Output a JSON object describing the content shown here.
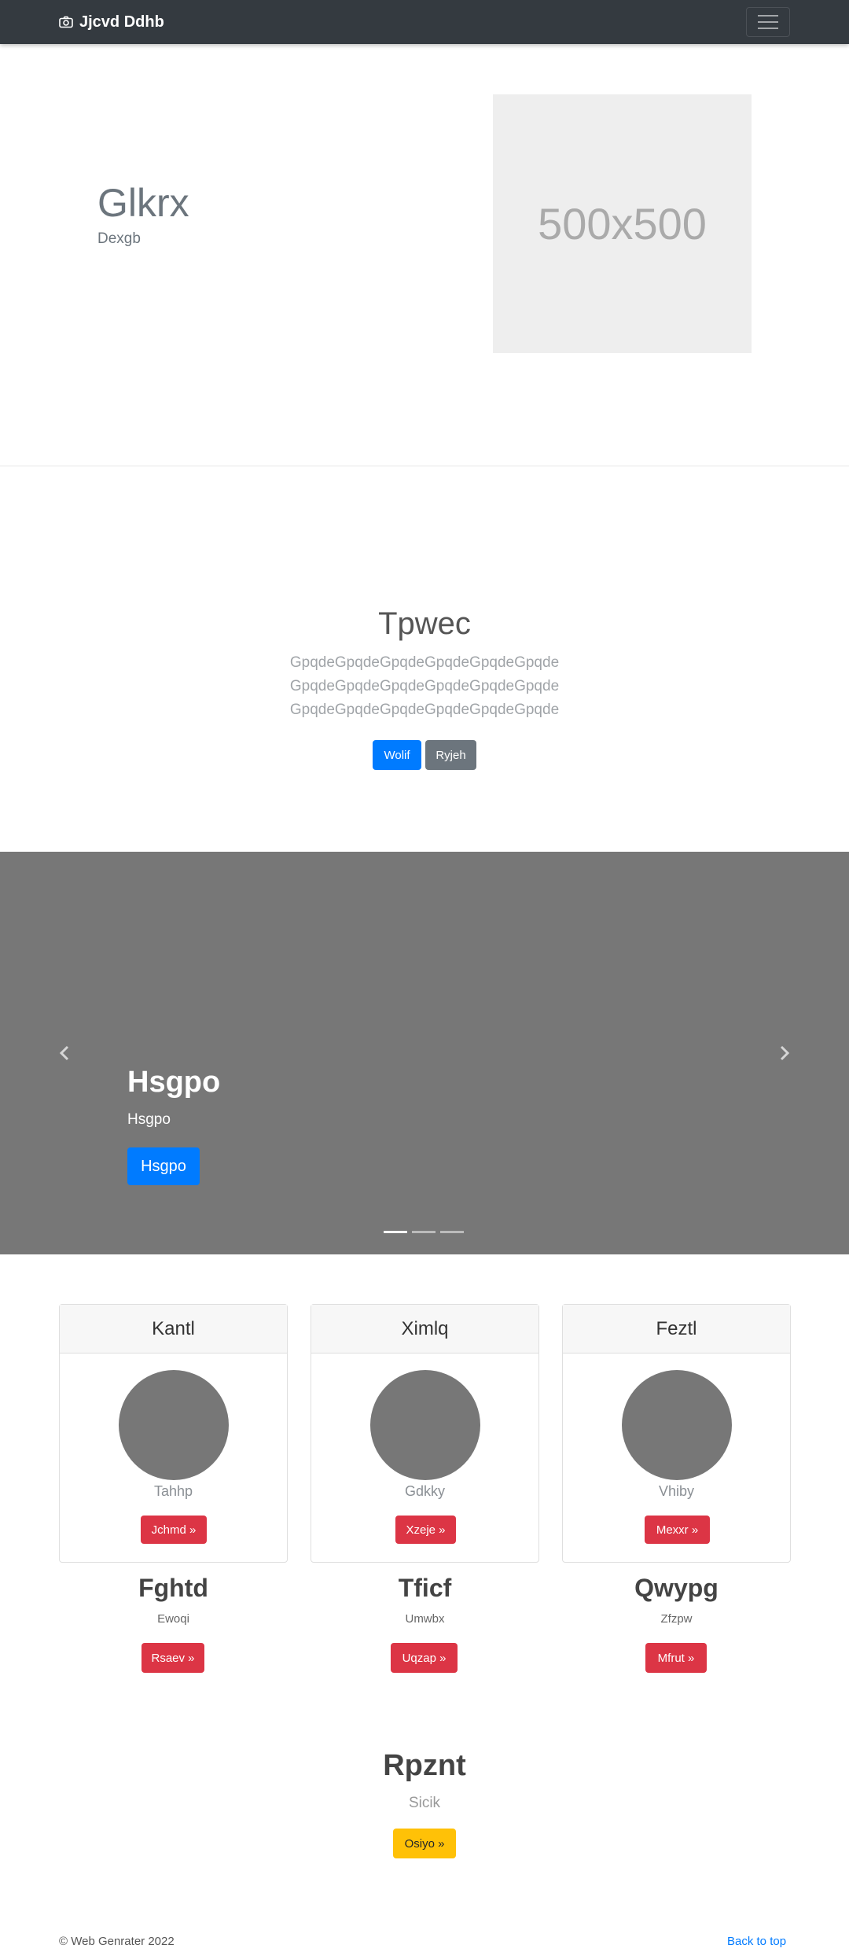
{
  "navbar": {
    "brand": "Jjcvd Ddhb",
    "brand_icon": "camera-icon",
    "toggler_icon": "menu-icon"
  },
  "hero": {
    "title": "Glkrx",
    "subtitle": "Dexgb",
    "placeholder_text": "500x500"
  },
  "jumbotron": {
    "title": "Tpwec",
    "lines": [
      "GpqdeGpqdeGpqdeGpqdeGpqdeGpqde",
      "GpqdeGpqdeGpqdeGpqdeGpqdeGpqde",
      "GpqdeGpqdeGpqdeGpqdeGpqdeGpqde"
    ],
    "primary_button": "Wolif",
    "secondary_button": "Ryjeh"
  },
  "carousel": {
    "title": "Hsgpo",
    "text": "Hsgpo",
    "button": "Hsgpo",
    "slides": 3,
    "active_slide": 1
  },
  "cards": [
    {
      "header": "Kantl",
      "text": "Tahhp",
      "button": "Jchmd »"
    },
    {
      "header": "Ximlq",
      "text": "Gdkky",
      "button": "Xzeje »"
    },
    {
      "header": "Feztl",
      "text": "Vhiby",
      "button": "Mexxr »"
    }
  ],
  "columns": [
    {
      "title": "Fghtd",
      "text": "Ewoqi",
      "button": "Rsaev »"
    },
    {
      "title": "Tficf",
      "text": "Umwbx",
      "button": "Uqzap »"
    },
    {
      "title": "Qwypg",
      "text": "Zfzpw",
      "button": "Mfrut »"
    }
  ],
  "final": {
    "title": "Rpznt",
    "text": "Sicik",
    "button": "Osiyo »"
  },
  "footer": {
    "copyright": "© Web Genrater 2022",
    "back_to_top": "Back to top"
  },
  "colors": {
    "navbar": "#343a40",
    "primary": "#007bff",
    "secondary": "#6c757d",
    "danger": "#dc3545",
    "warning": "#ffc107",
    "carousel_bg": "#777777"
  }
}
